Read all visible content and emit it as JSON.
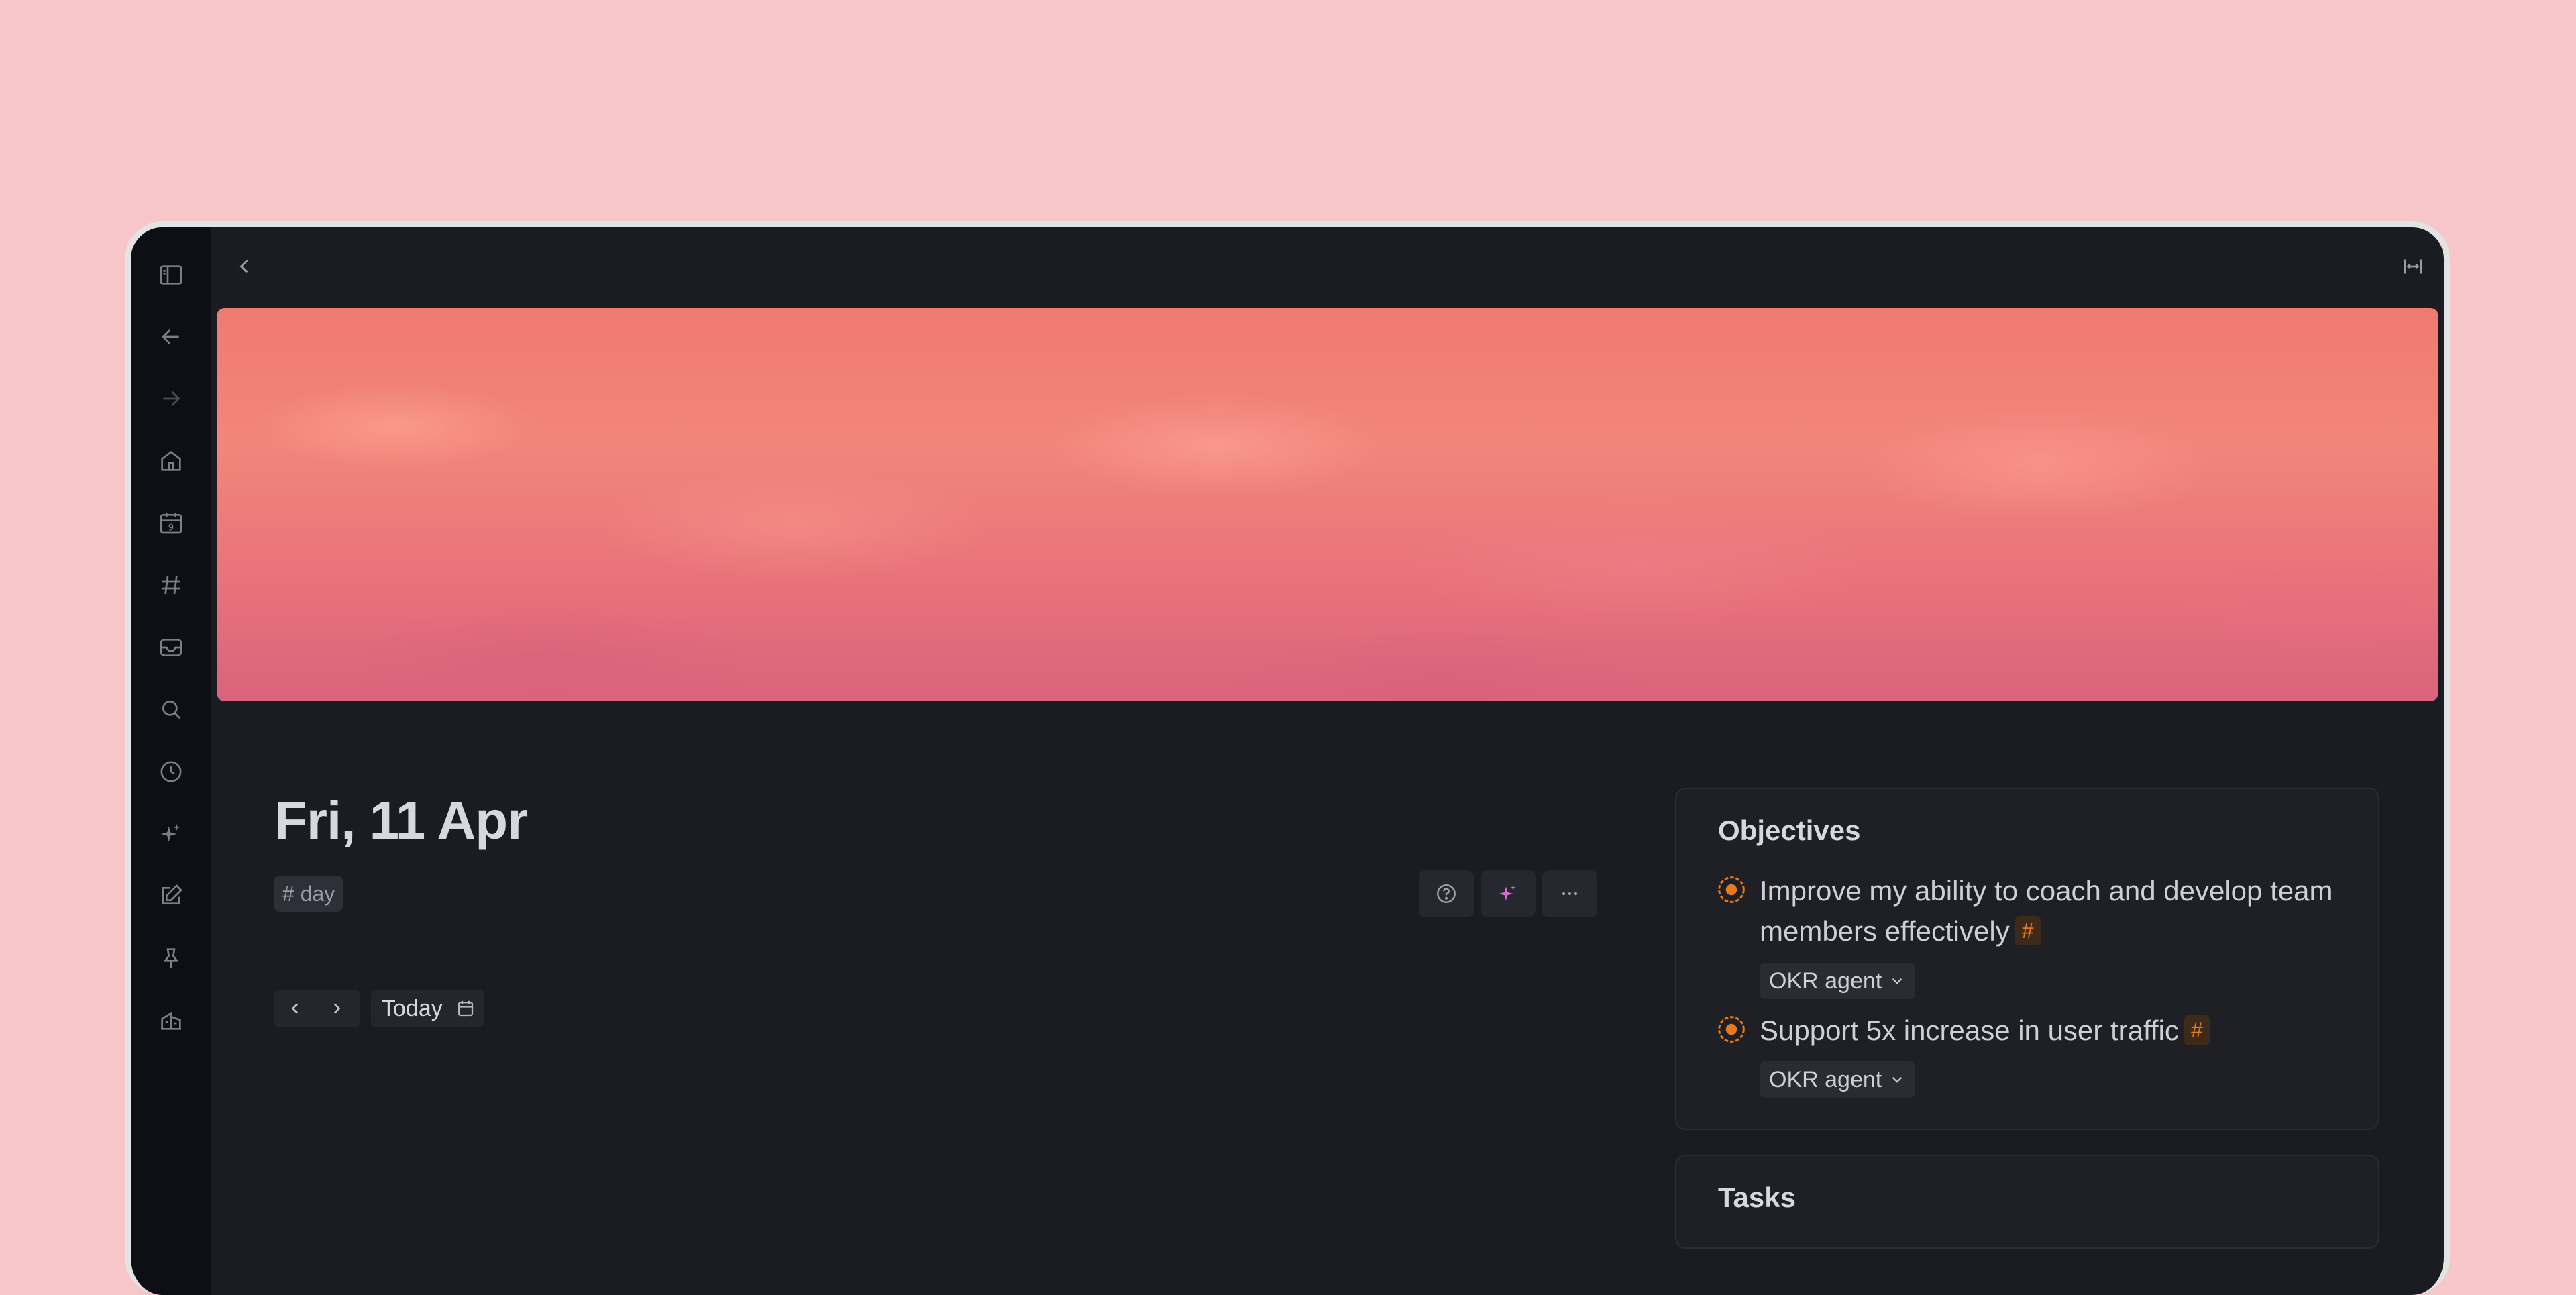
{
  "page": {
    "date_title": "Fri, 11 Apr",
    "tag": "# day",
    "today_label": "Today"
  },
  "sidebar": {
    "icons": [
      "sidebar-toggle-icon",
      "back-arrow-icon",
      "forward-arrow-icon",
      "home-icon",
      "calendar-icon",
      "hashtag-icon",
      "inbox-icon",
      "search-icon",
      "clock-icon",
      "sparkle-icon",
      "edit-icon",
      "pin-icon",
      "building-icon"
    ]
  },
  "objectives": {
    "title": "Objectives",
    "items": [
      {
        "text": "Improve my ability to coach and develop team members effectively",
        "badge": "#",
        "agent_label": "OKR agent"
      },
      {
        "text": "Support 5x increase in user traffic",
        "badge": "#",
        "agent_label": "OKR agent"
      }
    ]
  },
  "tasks": {
    "title": "Tasks"
  },
  "colors": {
    "background": "#f6c6c8",
    "window": "#1b1c21",
    "sidebar": "#0e0f14",
    "accent_orange": "#e8791c",
    "sparkle_pink": "#d86ad8"
  }
}
